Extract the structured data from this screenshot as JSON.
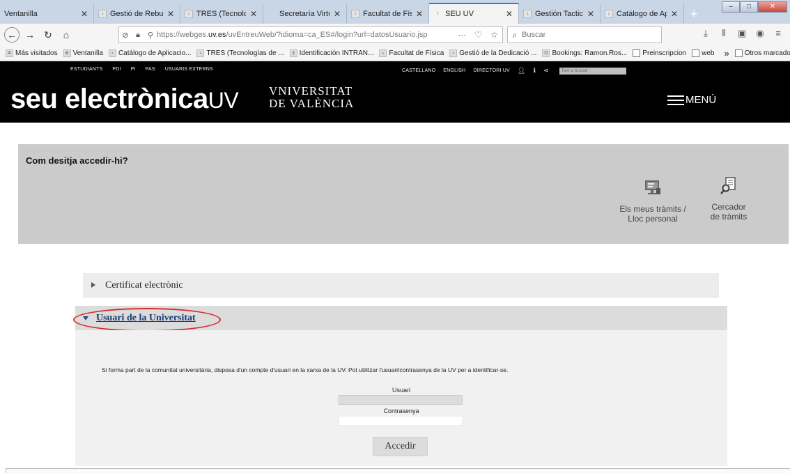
{
  "browser": {
    "tabs": [
      {
        "title": "Ventanilla",
        "width": 135
      },
      {
        "title": "Gestió de Rebuts",
        "width": 124
      },
      {
        "title": "TRES (Tecnologías",
        "width": 119
      },
      {
        "title": "Secretaría Virtual",
        "width": 120
      },
      {
        "title": "Facultat de Física",
        "width": 118
      },
      {
        "title": "SEU UV",
        "width": 129
      },
      {
        "title": "Gestión Tactica",
        "width": 117
      },
      {
        "title": "Catálogo de Aplic",
        "width": 120
      }
    ],
    "new_tab": "+",
    "url_prefix": "https://webges.",
    "url_domain": "uv.es",
    "url_suffix": "/uvEntreuWeb/?idioma=ca_ES#/login?url=datosUsuario.jsp",
    "search_placeholder": "Buscar",
    "bookmarks": [
      "Más visitados",
      "Ventanilla",
      "Catálogo de Aplicacio...",
      "TRES (Tecnologías de ...",
      "Identificación INTRAN...",
      "Facultat de Física",
      "Gestió de la Dedicació ...",
      "Bookings: Ramon.Ros...",
      "Preinscripcion",
      "web"
    ],
    "bookmarks_more": "»",
    "other_bookmarks": "Otros marcadores"
  },
  "site": {
    "topnav_left": [
      "ESTUDIANTS",
      "PDI",
      "PI",
      "PAS",
      "USUARIS EXTERNS"
    ],
    "topnav_right": [
      "CASTELLANO",
      "ENGLISH",
      "DIRECTORI UV"
    ],
    "topnav_search_placeholder": "Text a buscar",
    "logo_main": "seu electrònica",
    "logo_uv": "UV",
    "univ_line1": "VNIVERSITAT",
    "univ_line2": "DE VALÈNCIA",
    "menu_label": "MENÚ",
    "access_question": "Com desitja accedir-hi?",
    "option_personal_line1": "Els meus tràmits /",
    "option_personal_line2": "Lloc personal",
    "option_search_line1": "Cercador",
    "option_search_line2": "de tràmits",
    "cert_label": "Certificat electrònic",
    "uni_label": "Usuari de la Universitat",
    "uni_description": "Si forma part de la comunitat universitària, disposa d'un compte d'usuari en la xarxa de la UV. Pot utilitzar l'usuari/contrasenya de la UV per a identificar-se.",
    "user_label": "Usuari",
    "password_label": "Contrasenya",
    "submit_label": "Accedir",
    "highlight_color": "#d42c2c"
  }
}
